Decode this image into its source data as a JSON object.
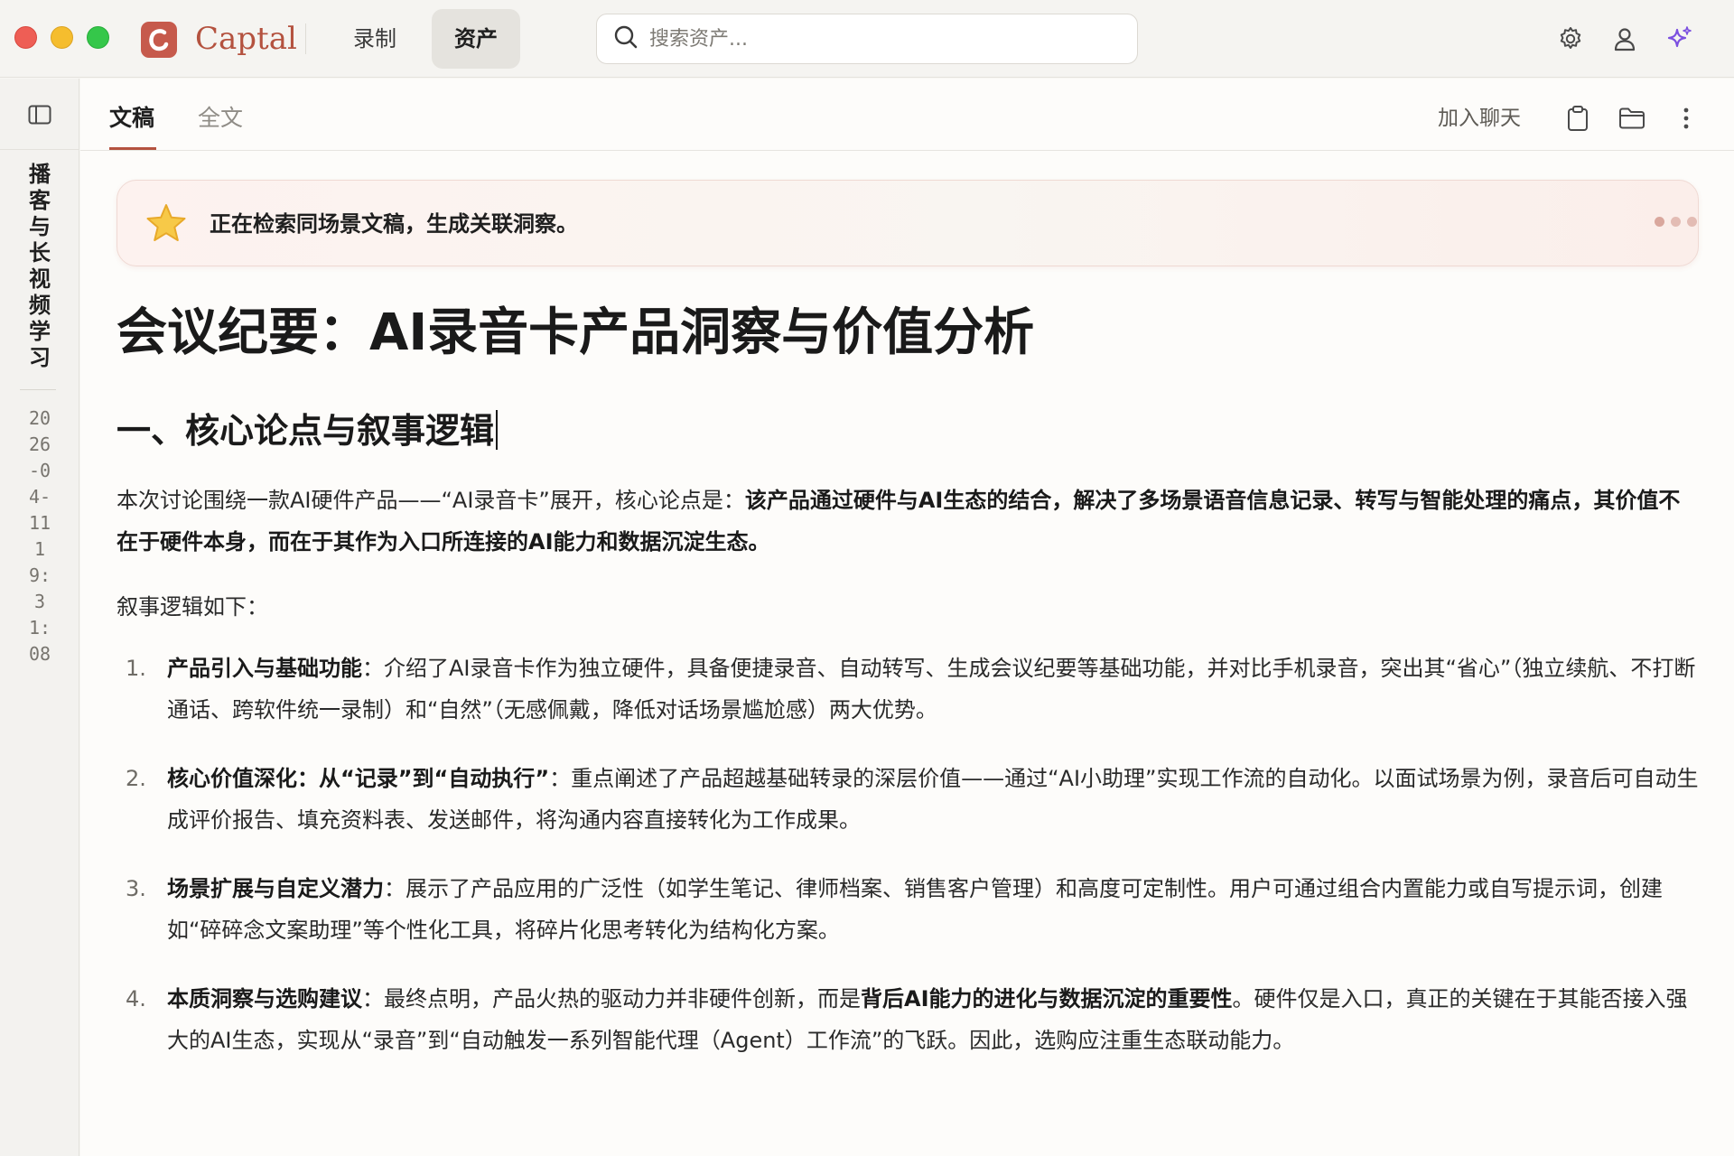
{
  "app": {
    "name": "Captal",
    "nav": {
      "record": "录制",
      "assets": "资产"
    },
    "search_placeholder": "搜索资产..."
  },
  "rail": {
    "title": "播客与长视频学习",
    "datetime": "2026-04-11 19:31:08"
  },
  "tabs": {
    "draft": "文稿",
    "full": "全文"
  },
  "header_actions": {
    "join_chat": "加入聊天"
  },
  "banner": {
    "text": "正在检索同场景文稿，生成关联洞察。"
  },
  "doc": {
    "title": "会议纪要：AI录音卡产品洞察与价值分析",
    "section1_heading": "一、核心论点与叙事逻辑",
    "intro": {
      "prefix": "本次讨论围绕一款AI硬件产品——“AI录音卡”展开，核心论点是：",
      "bold": "该产品通过硬件与AI生态的结合，解决了多场景语音信息记录、转写与智能处理的痛点，其价值不在于硬件本身，而在于其作为入口所连接的AI能力和数据沉淀生态。"
    },
    "narrative_label": "叙事逻辑如下：",
    "items": [
      {
        "num": "1.",
        "bold": "产品引入与基础功能",
        "text": "：介绍了AI录音卡作为独立硬件，具备便捷录音、自动转写、生成会议纪要等基础功能，并对比手机录音，突出其“省心”（独立续航、不打断通话、跨软件统一录制）和“自然”（无感佩戴，降低对话场景尴尬感）两大优势。"
      },
      {
        "num": "2.",
        "bold": "核心价值深化：从“记录”到“自动执行”",
        "text": "：重点阐述了产品超越基础转录的深层价值——通过“AI小助理”实现工作流的自动化。以面试场景为例，录音后可自动生成评价报告、填充资料表、发送邮件，将沟通内容直接转化为工作成果。"
      },
      {
        "num": "3.",
        "bold": "场景扩展与自定义潜力",
        "text": "：展示了产品应用的广泛性（如学生笔记、律师档案、销售客户管理）和高度可定制性。用户可通过组合内置能力或自写提示词，创建如“碎碎念文案助理”等个性化工具，将碎片化思考转化为结构化方案。"
      },
      {
        "num": "4.",
        "bold": "本质洞察与选购建议",
        "text_before": "：最终点明，产品火热的驱动力并非硬件创新，而是",
        "bold2": "背后AI能力的进化与数据沉淀的重要性",
        "text_after": "。硬件仅是入口，真正的关键在于其能否接入强大的AI生态，实现从“录音”到“自动触发一系列智能代理（Agent）工作流”的飞跃。因此，选购应注重生态联动能力。"
      }
    ]
  },
  "colors": {
    "brand": "#b4523f",
    "logo_bg": "#c65a4c",
    "sparkle": "#7b4fe0"
  },
  "icons": [
    "search-icon",
    "settings-icon",
    "user-icon",
    "sparkle-icon",
    "sidebar-toggle-icon",
    "clipboard-icon",
    "folder-icon",
    "more-icon",
    "star-icon"
  ]
}
